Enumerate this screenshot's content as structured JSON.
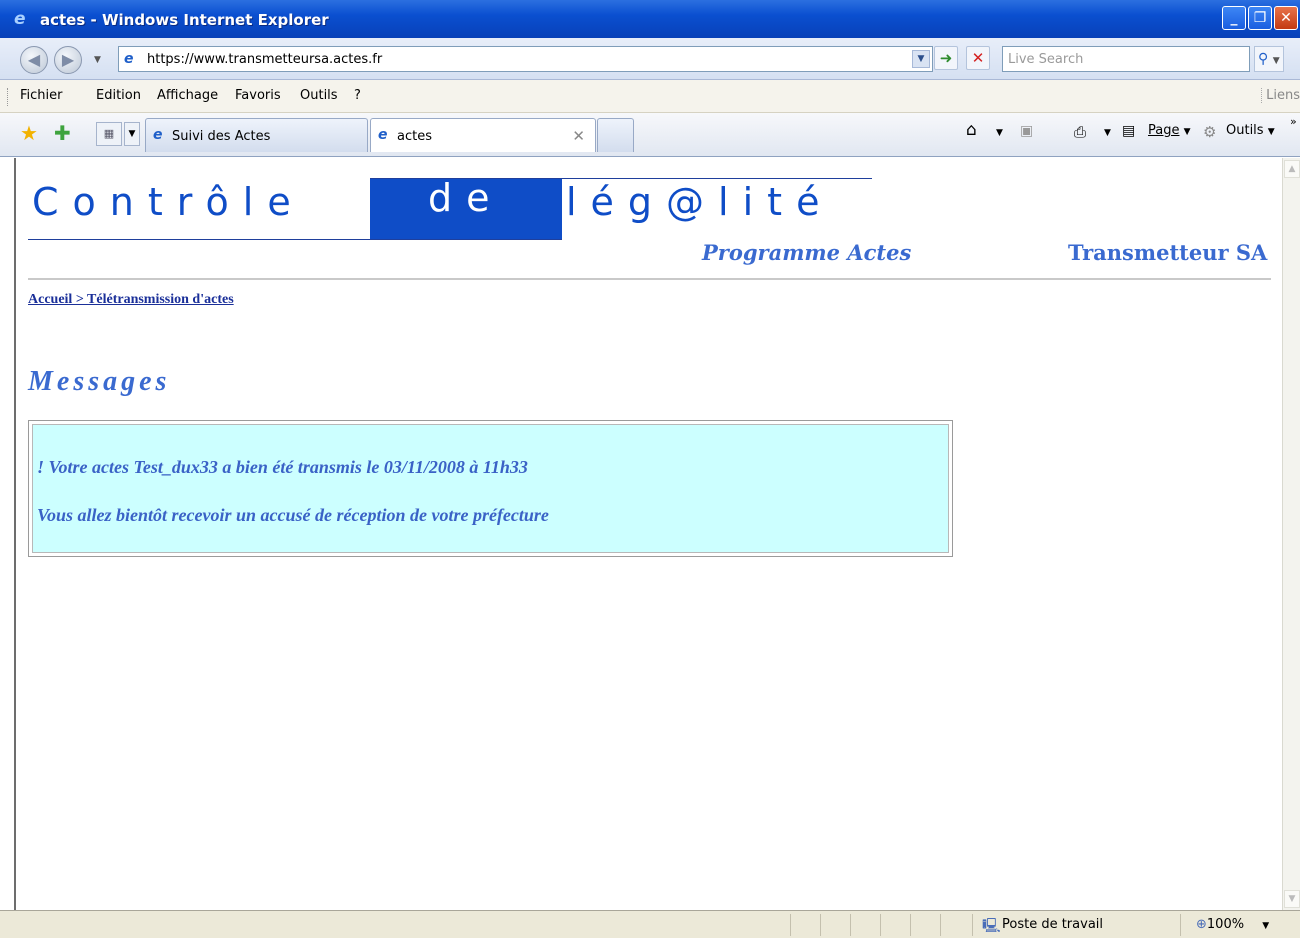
{
  "window": {
    "title": "actes - Windows Internet Explorer"
  },
  "addressbar": {
    "url": "https://www.transmetteursa.actes.fr",
    "search_placeholder": "Live Search"
  },
  "menubar": {
    "items": [
      "Fichier",
      "Edition",
      "Affichage",
      "Favoris",
      "Outils",
      "?"
    ],
    "links_label": "Liens"
  },
  "tabs": [
    {
      "label": "Suivi des Actes",
      "active": false
    },
    {
      "label": "actes",
      "active": true
    }
  ],
  "commandbar": {
    "page_label": "Page",
    "tools_label": "Outils"
  },
  "page": {
    "logo": {
      "word1": "Contrôle",
      "word2": "de",
      "word3": "lég@lité"
    },
    "program": "Programme Actes",
    "company": "Transmetteur SA",
    "breadcrumb": "Accueil > Télétransmission d'actes",
    "messages_title": "Messages",
    "message1": "! Votre actes Test_dux33 a bien été transmis le 03/11/2008 à 11h33",
    "message2": "Vous allez bientôt recevoir un accusé de réception de votre préfecture"
  },
  "statusbar": {
    "zone": "Poste de travail",
    "zoom": "100%"
  },
  "colors": {
    "accent": "#0f4dc7",
    "message_bg": "#ccffff",
    "text_blue": "#3a6ad0"
  }
}
